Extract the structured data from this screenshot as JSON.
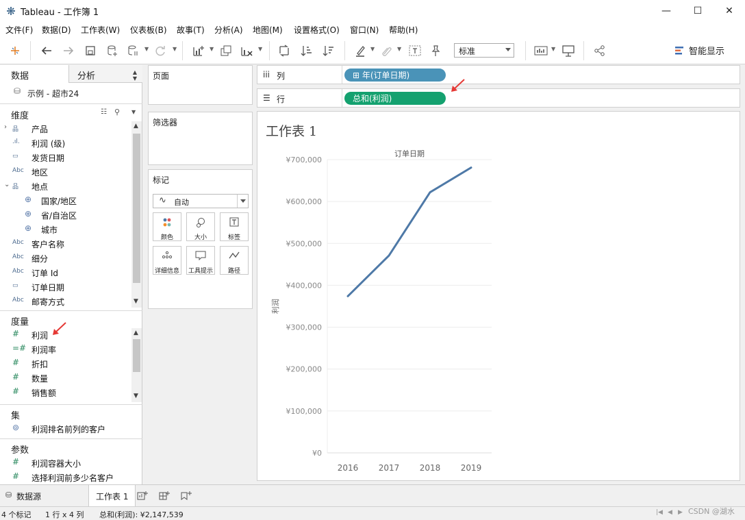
{
  "window": {
    "title": "Tableau - 工作簿 1",
    "minimize": "—",
    "maximize": "☐",
    "close": "✕"
  },
  "menu": [
    "文件(F)",
    "数据(D)",
    "工作表(W)",
    "仪表板(B)",
    "故事(T)",
    "分析(A)",
    "地图(M)",
    "设置格式(O)",
    "窗口(N)",
    "帮助(H)"
  ],
  "toolbar": {
    "fit_select": "标准",
    "show_me": "智能显示"
  },
  "data_pane": {
    "tab_data": "数据",
    "tab_analysis": "分析",
    "datasource": "示例 - 超市24",
    "dimensions_header": "维度",
    "dimensions": [
      {
        "label": "产品",
        "icon": "hierarchy-icon",
        "expand": "›"
      },
      {
        "label": "利润 (级)",
        "icon": "bin-icon"
      },
      {
        "label": "发货日期",
        "icon": "calendar-icon"
      },
      {
        "label": "地区",
        "icon": "abc-icon"
      },
      {
        "label": "地点",
        "icon": "hierarchy-icon",
        "expand": "⌄"
      },
      {
        "label": "国家/地区",
        "icon": "globe-icon",
        "sub": true
      },
      {
        "label": "省/自治区",
        "icon": "globe-icon",
        "sub": true
      },
      {
        "label": "城市",
        "icon": "globe-icon",
        "sub": true
      },
      {
        "label": "客户名称",
        "icon": "abc-icon"
      },
      {
        "label": "细分",
        "icon": "abc-icon"
      },
      {
        "label": "订单 Id",
        "icon": "abc-icon"
      },
      {
        "label": "订单日期",
        "icon": "calendar-icon"
      },
      {
        "label": "邮寄方式",
        "icon": "abc-icon"
      }
    ],
    "measures_header": "度量",
    "measures": [
      {
        "label": "利润",
        "icon": "hash-icon"
      },
      {
        "label": "利润率",
        "icon": "calc-hash-icon"
      },
      {
        "label": "折扣",
        "icon": "hash-icon"
      },
      {
        "label": "数量",
        "icon": "hash-icon"
      },
      {
        "label": "销售额",
        "icon": "hash-icon"
      }
    ],
    "sets_header": "集",
    "sets": [
      {
        "label": "利润排名前列的客户",
        "icon": "set-icon"
      }
    ],
    "params_header": "参数",
    "params": [
      {
        "label": "利润容器大小",
        "icon": "hash-icon"
      },
      {
        "label": "选择利润前多少名客户",
        "icon": "hash-icon"
      }
    ]
  },
  "cards": {
    "pages": "页面",
    "filters": "筛选器",
    "marks": "标记",
    "mark_type": "自动",
    "mark_buttons": [
      "颜色",
      "大小",
      "标签",
      "详细信息",
      "工具提示",
      "路径"
    ]
  },
  "shelves": {
    "columns_label": "列",
    "columns_pill": "⊞ 年(订单日期)",
    "rows_label": "行",
    "rows_pill": "总和(利润)"
  },
  "sheet": {
    "title": "工作表 1"
  },
  "chart_data": {
    "type": "line",
    "title": "订单日期",
    "xlabel": "",
    "ylabel": "利润",
    "categories": [
      "2016",
      "2017",
      "2018",
      "2019"
    ],
    "series": [
      {
        "values": [
          374000,
          471000,
          622000,
          681000
        ]
      }
    ],
    "y_ticks": [
      "¥0",
      "¥100,000",
      "¥200,000",
      "¥300,000",
      "¥400,000",
      "¥500,000",
      "¥600,000",
      "¥700,000"
    ],
    "ylim": [
      0,
      700000
    ],
    "grid": true,
    "line_color": "#4e79a7"
  },
  "bottom": {
    "datasource_tab": "数据源",
    "sheet_tab": "工作表 1"
  },
  "status": {
    "marks": "4 个标记",
    "dims": "1 行 x 4 列",
    "sum": "总和(利润): ¥2,147,539"
  },
  "watermark": "CSDN @湖水"
}
